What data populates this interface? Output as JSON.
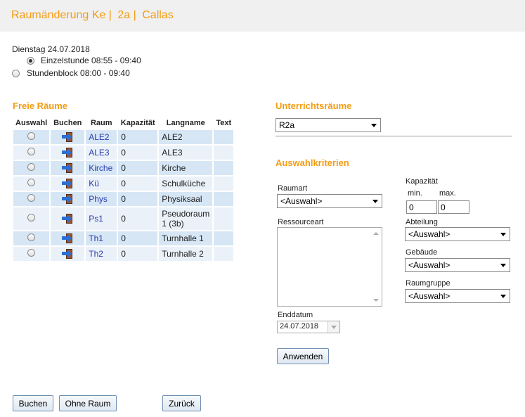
{
  "header": {
    "part1": "Raumänderung Ke |",
    "part2": "2a |",
    "part3": "Callas"
  },
  "date": "Dienstag 24.07.2018",
  "time_options": [
    {
      "label": "Einzelstunde 08:55 - 09:40",
      "selected": true
    },
    {
      "label": "Stundenblock 08:00 - 09:40",
      "selected": false
    }
  ],
  "free_rooms": {
    "title": "Freie Räume",
    "columns": [
      "Auswahl",
      "Buchen",
      "Raum",
      "Kapazität",
      "Langname",
      "Text"
    ],
    "rows": [
      {
        "room": "ALE2",
        "capacity": "0",
        "longname": "ALE2",
        "text": ""
      },
      {
        "room": "ALE3",
        "capacity": "0",
        "longname": "ALE3",
        "text": ""
      },
      {
        "room": "Kirche",
        "capacity": "0",
        "longname": "Kirche",
        "text": ""
      },
      {
        "room": "Kü",
        "capacity": "0",
        "longname": "Schulküche",
        "text": ""
      },
      {
        "room": "Phys",
        "capacity": "0",
        "longname": "Physiksaal",
        "text": ""
      },
      {
        "room": "Ps1",
        "capacity": "0",
        "longname": "Pseudoraum 1 (3b)",
        "text": ""
      },
      {
        "room": "Th1",
        "capacity": "0",
        "longname": "Turnhalle 1",
        "text": ""
      },
      {
        "room": "Th2",
        "capacity": "0",
        "longname": "Turnhalle 2",
        "text": ""
      }
    ]
  },
  "teaching_rooms": {
    "title": "Unterrichtsräume",
    "selected": "R2a"
  },
  "criteria": {
    "title": "Auswahlkriterien",
    "raumart_label": "Raumart",
    "raumart_value": "<Auswahl>",
    "ressourceart_label": "Ressourceart",
    "kapazitaet_label": "Kapazität",
    "min_label": "min.",
    "max_label": "max.",
    "min_value": "0",
    "max_value": "0",
    "abteilung_label": "Abteilung",
    "abteilung_value": "<Auswahl>",
    "gebaeude_label": "Gebäude",
    "gebaeude_value": "<Auswahl>",
    "raumgruppe_label": "Raumgruppe",
    "raumgruppe_value": "<Auswahl>",
    "enddatum_label": "Enddatum",
    "enddatum_value": "24.07.2018",
    "apply_label": "Anwenden"
  },
  "footer": {
    "book_label": "Buchen",
    "no_room_label": "Ohne Raum",
    "back_label": "Zurück"
  },
  "colors": {
    "accent": "#f39c12",
    "row_odd": "#d6e6f5",
    "row_even": "#eaf1f9",
    "link": "#2a3cb0"
  }
}
